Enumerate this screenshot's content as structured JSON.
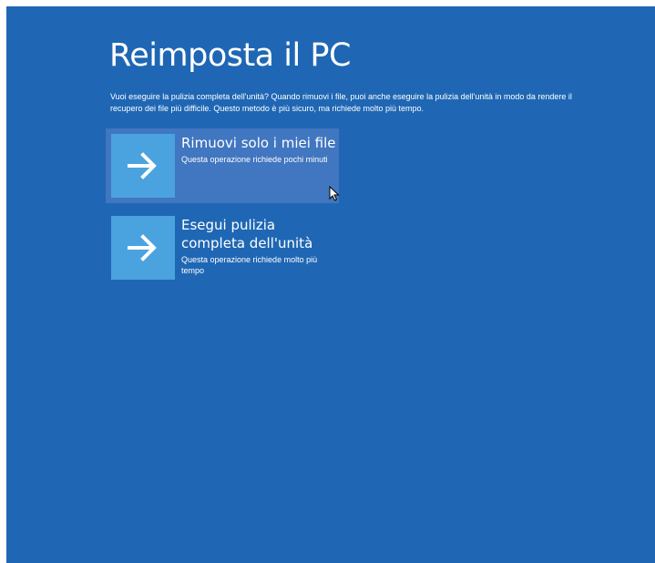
{
  "page": {
    "title": "Reimposta il PC",
    "description": "Vuoi eseguire la pulizia completa dell'unità? Quando rimuovi i file, puoi anche eseguire la pulizia dell'unità in modo da rendere il recupero dei file più difficile. Questo metodo è più sicuro, ma richiede molto più tempo."
  },
  "options": [
    {
      "title": "Rimuovi solo i miei file",
      "description": "Questa operazione richiede pochi minuti",
      "icon": "arrow-right-icon",
      "hovered": true
    },
    {
      "title": "Esegui pulizia completa dell'unità",
      "description": "Questa operazione richiede molto più tempo",
      "icon": "arrow-right-icon",
      "hovered": false
    }
  ],
  "colors": {
    "background": "#1f67b4",
    "tile": "#4aa3df",
    "hover": "#4176c0",
    "text": "#ffffff"
  }
}
